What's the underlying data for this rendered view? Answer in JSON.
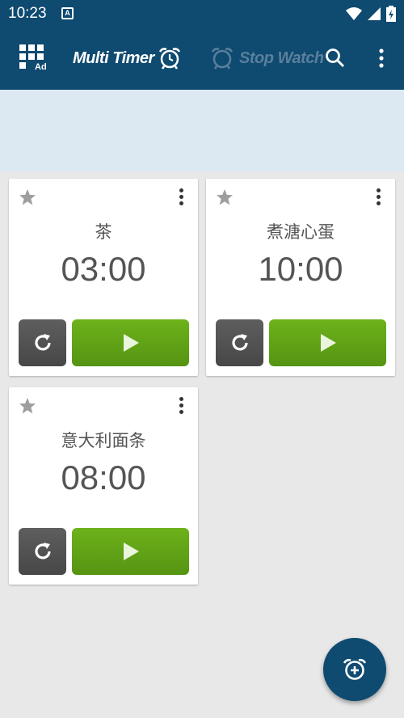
{
  "status_bar": {
    "time": "10:23",
    "notification_icon": "A"
  },
  "app_bar": {
    "ad_label": "Ad",
    "tabs": [
      {
        "label": "Multi Timer",
        "icon": "alarm-clock-icon",
        "selected": true
      },
      {
        "label": "Stop Watch",
        "icon": "stopwatch-icon",
        "selected": false
      }
    ]
  },
  "timers": [
    {
      "name": "茶",
      "time": "03:00"
    },
    {
      "name": "煮溏心蛋",
      "time": "10:00"
    },
    {
      "name": "意大利面条",
      "time": "08:00"
    }
  ],
  "colors": {
    "primary": "#0f4a70",
    "tab_indicator": "#e5e832",
    "play_green": "#62a517",
    "reset_gray": "#555555",
    "ad_area": "#dde9f2",
    "background": "#e8e8e8"
  }
}
